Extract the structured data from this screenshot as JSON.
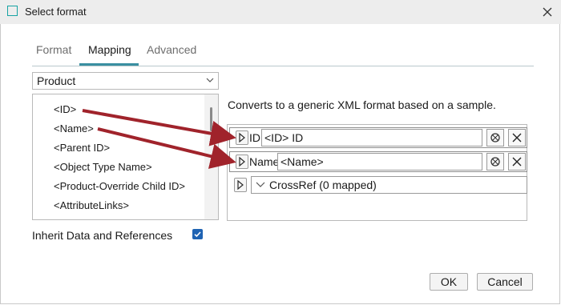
{
  "window": {
    "title": "Select format",
    "close_icon": "close-icon"
  },
  "tabs": [
    {
      "label": "Format",
      "active": false
    },
    {
      "label": "Mapping",
      "active": true
    },
    {
      "label": "Advanced",
      "active": false
    }
  ],
  "object_type": {
    "selected": "Product"
  },
  "source_list": {
    "items": [
      "<ID>",
      "<Name>",
      "<Parent ID>",
      "<Object Type Name>",
      "<Product-Override Child ID>",
      "<AttributeLinks>"
    ]
  },
  "inherit": {
    "label": "Inherit Data and References",
    "checked": true
  },
  "description": "Converts to a generic XML format based on a sample.",
  "mappings": [
    {
      "label": "ID",
      "value": "<ID> ID"
    },
    {
      "label": "Name",
      "value": "<Name>"
    }
  ],
  "crossref": {
    "label": "CrossRef (0 mapped)"
  },
  "buttons": {
    "ok": "OK",
    "cancel": "Cancel"
  },
  "colors": {
    "accent": "#3a8fa1",
    "checkbox": "#1f63b3",
    "arrow": "#a0232b"
  }
}
